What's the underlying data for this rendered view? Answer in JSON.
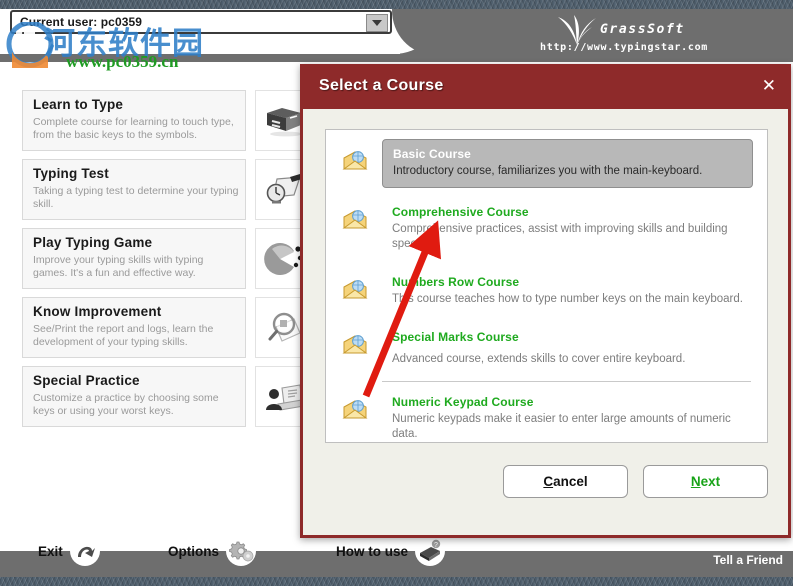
{
  "window": {
    "brand_name": "GrassSoft",
    "brand_url": "http://www.typingstar.com",
    "grass_icon": "grass-leaf-icon"
  },
  "user_selector": {
    "value": "Current user: pc0359",
    "dropdown_icon": "chevron-down-icon"
  },
  "watermark": {
    "chinese_text": "河东软件园",
    "url": "www.pc0359.cn",
    "logo_icon": "pc0359-logo-icon"
  },
  "menu": {
    "items": [
      {
        "title": "Learn to Type",
        "desc": "Complete course for learning to touch type, from the basic keys to the symbols.",
        "icon": "books-icon"
      },
      {
        "title": "Typing Test",
        "desc": "Taking a typing test to determine your typing skill.",
        "icon": "clock-pen-icon"
      },
      {
        "title": "Play Typing Game",
        "desc": "Improve your typing skills with typing games. It's a fun and effective way.",
        "icon": "pacman-game-icon"
      },
      {
        "title": "Know Improvement",
        "desc": "See/Print the report and logs, learn the development of your typing skills.",
        "icon": "magnifier-report-icon"
      },
      {
        "title": "Special Practice",
        "desc": "Customize a practice by choosing some keys or using your worst keys.",
        "icon": "person-laptop-icon"
      }
    ]
  },
  "dialog": {
    "title": "Select a Course",
    "close_icon": "close-icon",
    "courses": [
      {
        "name": "Basic Course",
        "desc": "Introductory course, familiarizes you with the main-keyboard.",
        "icon": "open-envelope-icon",
        "selected": true,
        "separator_after": false
      },
      {
        "name": "Comprehensive Course",
        "desc": "Comprehensive practices, assist with improving skills and building speed.",
        "icon": "open-envelope-icon",
        "selected": false,
        "separator_after": false
      },
      {
        "name": "Numbers Row Course",
        "desc": "This course teaches how to type number keys on the main keyboard.",
        "icon": "open-envelope-icon",
        "selected": false,
        "separator_after": false
      },
      {
        "name": "Special Marks Course",
        "desc": "Advanced course, extends skills to cover entire keyboard.",
        "icon": "open-envelope-icon",
        "selected": false,
        "separator_after": true
      },
      {
        "name": "Numeric Keypad Course",
        "desc": "Numeric keypads make it easier to enter large amounts of numeric data.",
        "icon": "open-envelope-icon",
        "selected": false,
        "separator_after": false
      }
    ],
    "cancel_label": "Cancel",
    "cancel_accel": "C",
    "next_label": "Next",
    "next_accel": "N"
  },
  "toolbar": {
    "exit_label": "Exit",
    "exit_icon": "exit-arrow-icon",
    "options_label": "Options",
    "options_icon": "gears-icon",
    "howto_label": "How to use",
    "howto_icon": "help-book-icon",
    "tell_friend_label": "Tell a Friend"
  },
  "colors": {
    "accent_red": "#8e2a2a",
    "header_grey": "#6e6e6e",
    "course_green": "#1faa1f",
    "annotation_red": "#e01b10",
    "strip_blue": "#50606e"
  }
}
